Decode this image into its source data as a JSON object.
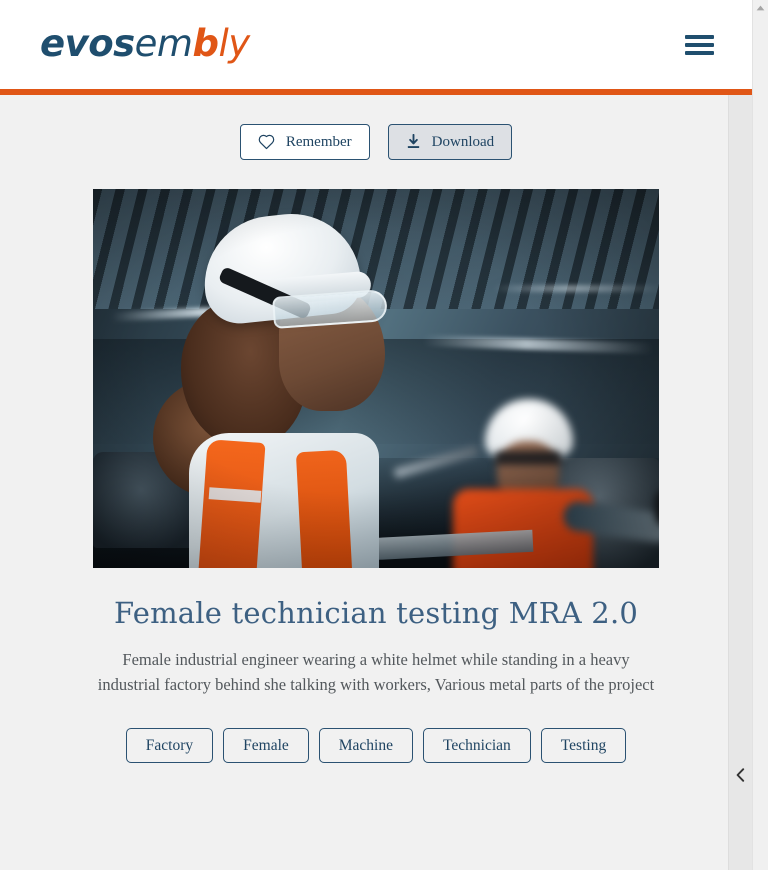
{
  "header": {
    "logo": {
      "part1": "evos",
      "part2": "em",
      "part3": "b",
      "part4": "ly",
      "navy": "#1f4e6e",
      "orange": "#e05616"
    },
    "menu_button_name": "hamburger-menu",
    "accent_color": "#e05616"
  },
  "actions": {
    "remember_label": "Remember",
    "remember_icon": "heart-outline-icon",
    "download_label": "Download",
    "download_icon": "download-icon"
  },
  "asset": {
    "title": "Female technician testing MRA 2.0",
    "description": "Female industrial engineer wearing a white helmet while standing in a heavy industrial factory behind she talking with workers, Various metal parts of the project",
    "image_alt": "Female industrial engineer in white helmet and orange safety vest in a factory, with a second worker behind her"
  },
  "tags": [
    {
      "label": "Factory"
    },
    {
      "label": "Female"
    },
    {
      "label": "Machine"
    },
    {
      "label": "Technician"
    },
    {
      "label": "Testing"
    }
  ],
  "side_rail": {
    "toggle_icon": "chevron-left-icon"
  },
  "scrollbar": {
    "up_icon": "scroll-up-arrow-icon",
    "down_icon": "scroll-down-arrow-icon"
  }
}
